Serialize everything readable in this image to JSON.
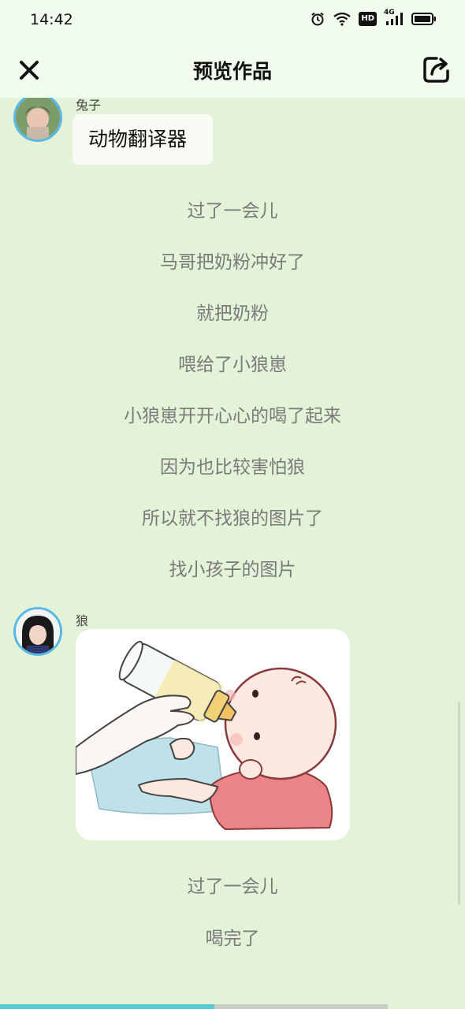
{
  "status_bar": {
    "time": "14:42",
    "icons": [
      "alarm-icon",
      "wifi-icon",
      "hd-icon",
      "4g-signal-icon",
      "battery-icon"
    ],
    "hd_label": "HD",
    "network_label": "4G"
  },
  "header": {
    "title": "预览作品",
    "close_icon": "close-icon",
    "share_icon": "share-icon"
  },
  "messages": [
    {
      "sender": "兔子",
      "text": "动物翻译器"
    }
  ],
  "narration_1": [
    "过了一会儿",
    "马哥把奶粉冲好了",
    "就把奶粉",
    "喂给了小狼崽",
    "小狼崽开开心心的喝了起来",
    "因为也比较害怕狼",
    "所以就不找狼的图片了",
    "找小孩子的图片"
  ],
  "image_message": {
    "sender": "狼",
    "image": "baby-bottle-feeding-illustration"
  },
  "narration_2": [
    "过了一会儿",
    "喝完了"
  ],
  "colors": {
    "background": "#e3f3d8",
    "header_bg": "#f2fcee",
    "avatar_border": "#5ab7e6",
    "narration_text": "#7a7a7a",
    "progress_accent": "#55c9d4"
  }
}
